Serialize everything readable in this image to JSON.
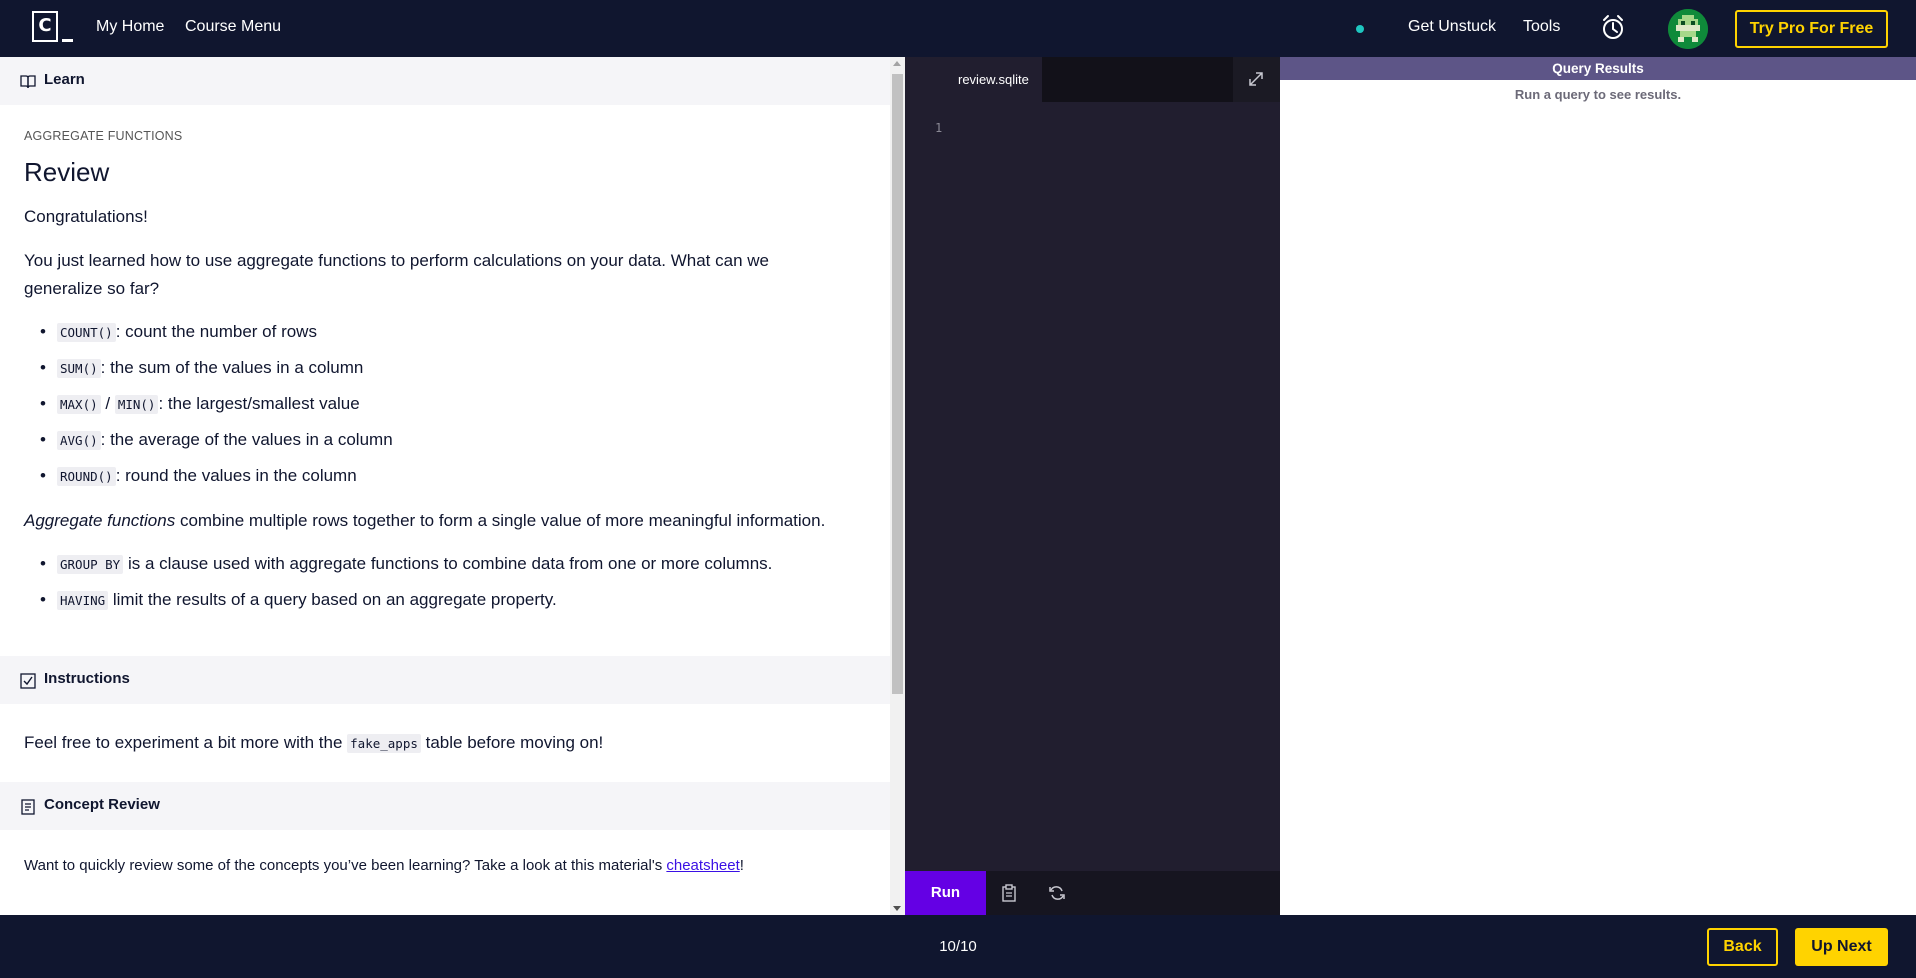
{
  "nav": {
    "logo_text": "C",
    "my_home": "My Home",
    "course_menu": "Course Menu",
    "get_unstuck": "Get Unstuck",
    "tools": "Tools",
    "try_pro": "Try Pro For Free"
  },
  "lesson": {
    "learn_header": "Learn",
    "eyebrow": "AGGREGATE FUNCTIONS",
    "title": "Review",
    "congrats": "Congratulations!",
    "intro": "You just learned how to use aggregate functions to perform calculations on your data. What can we generalize so far?",
    "list1": [
      {
        "code": "COUNT()",
        "text": ": count the number of rows"
      },
      {
        "code": "SUM()",
        "text": ": the sum of the values in a column"
      },
      {
        "code": "MAX()",
        "sep": " / ",
        "code2": "MIN()",
        "text": ": the largest/smallest value"
      },
      {
        "code": "AVG()",
        "text": ": the average of the values in a column"
      },
      {
        "code": "ROUND()",
        "text": ": round the values in the column"
      }
    ],
    "agg_em": "Aggregate functions",
    "agg_rest": " combine multiple rows together to form a single value of more meaningful information.",
    "list2": [
      {
        "code": "GROUP BY",
        "text": " is a clause used with aggregate functions to combine data from one or more columns."
      },
      {
        "code": "HAVING",
        "text": " limit the results of a query based on an aggregate property."
      }
    ],
    "instructions_header": "Instructions",
    "instr_before": "Feel free to experiment a bit more with the ",
    "instr_code": "fake_apps",
    "instr_after": " table before moving on!",
    "concept_header": "Concept Review",
    "concept_before": "Want to quickly review some of the concepts you’ve been learning? Take a look at this material's ",
    "concept_link": "cheatsheet",
    "concept_after": "!"
  },
  "editor": {
    "tab_name": "review.sqlite",
    "line_number": "1",
    "run_label": "Run"
  },
  "results": {
    "header": "Query Results",
    "empty_message": "Run a query to see results."
  },
  "footer": {
    "progress": "10/10",
    "back": "Back",
    "up_next": "Up Next"
  },
  "colors": {
    "nav_bg": "#10162f",
    "accent_yellow": "#ffd300",
    "run_purple": "#6400e4",
    "results_header": "#5d5587",
    "status_dot": "#1ec6c0"
  },
  "icons": [
    "book-icon",
    "checkbox-icon",
    "document-icon",
    "expand-icon",
    "clipboard-icon",
    "refresh-icon",
    "alarm-clock-icon"
  ]
}
